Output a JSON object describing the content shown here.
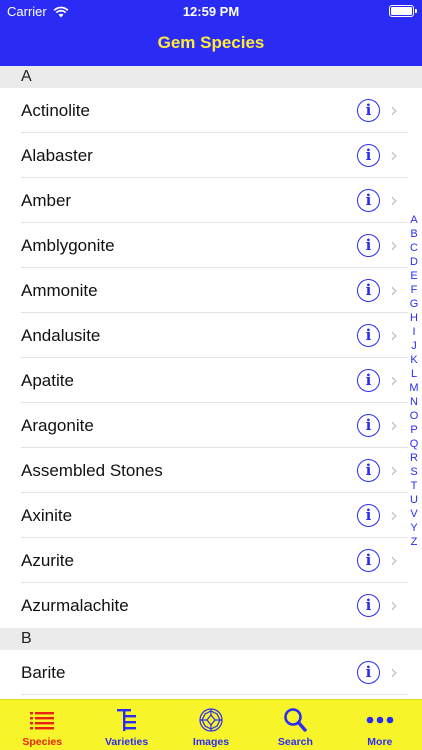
{
  "status_bar": {
    "carrier": "Carrier",
    "time": "12:59 PM"
  },
  "nav": {
    "title": "Gem Species"
  },
  "sections": [
    {
      "letter": "A",
      "items": [
        "Actinolite",
        "Alabaster",
        "Amber",
        "Amblygonite",
        "Ammonite",
        "Andalusite",
        "Apatite",
        "Aragonite",
        "Assembled Stones",
        "Axinite",
        "Azurite",
        "Azurmalachite"
      ]
    },
    {
      "letter": "B",
      "items": [
        "Barite"
      ]
    }
  ],
  "index_letters": [
    "A",
    "B",
    "C",
    "D",
    "E",
    "F",
    "G",
    "H",
    "I",
    "J",
    "K",
    "L",
    "M",
    "N",
    "O",
    "P",
    "Q",
    "R",
    "S",
    "T",
    "U",
    "V",
    "Y",
    "Z"
  ],
  "tabs": [
    {
      "label": "Species",
      "icon": "list-icon",
      "active": true
    },
    {
      "label": "Varieties",
      "icon": "tree-list-icon",
      "active": false
    },
    {
      "label": "Images",
      "icon": "gem-icon",
      "active": false
    },
    {
      "label": "Search",
      "icon": "search-icon",
      "active": false
    },
    {
      "label": "More",
      "icon": "more-dots-icon",
      "active": false
    }
  ],
  "colors": {
    "nav_bg": "#2a2cf5",
    "title": "#ffeb3b",
    "tab_bg": "#f7f52a",
    "tab_active": "#e8230f",
    "accent": "#2a2cf5"
  }
}
